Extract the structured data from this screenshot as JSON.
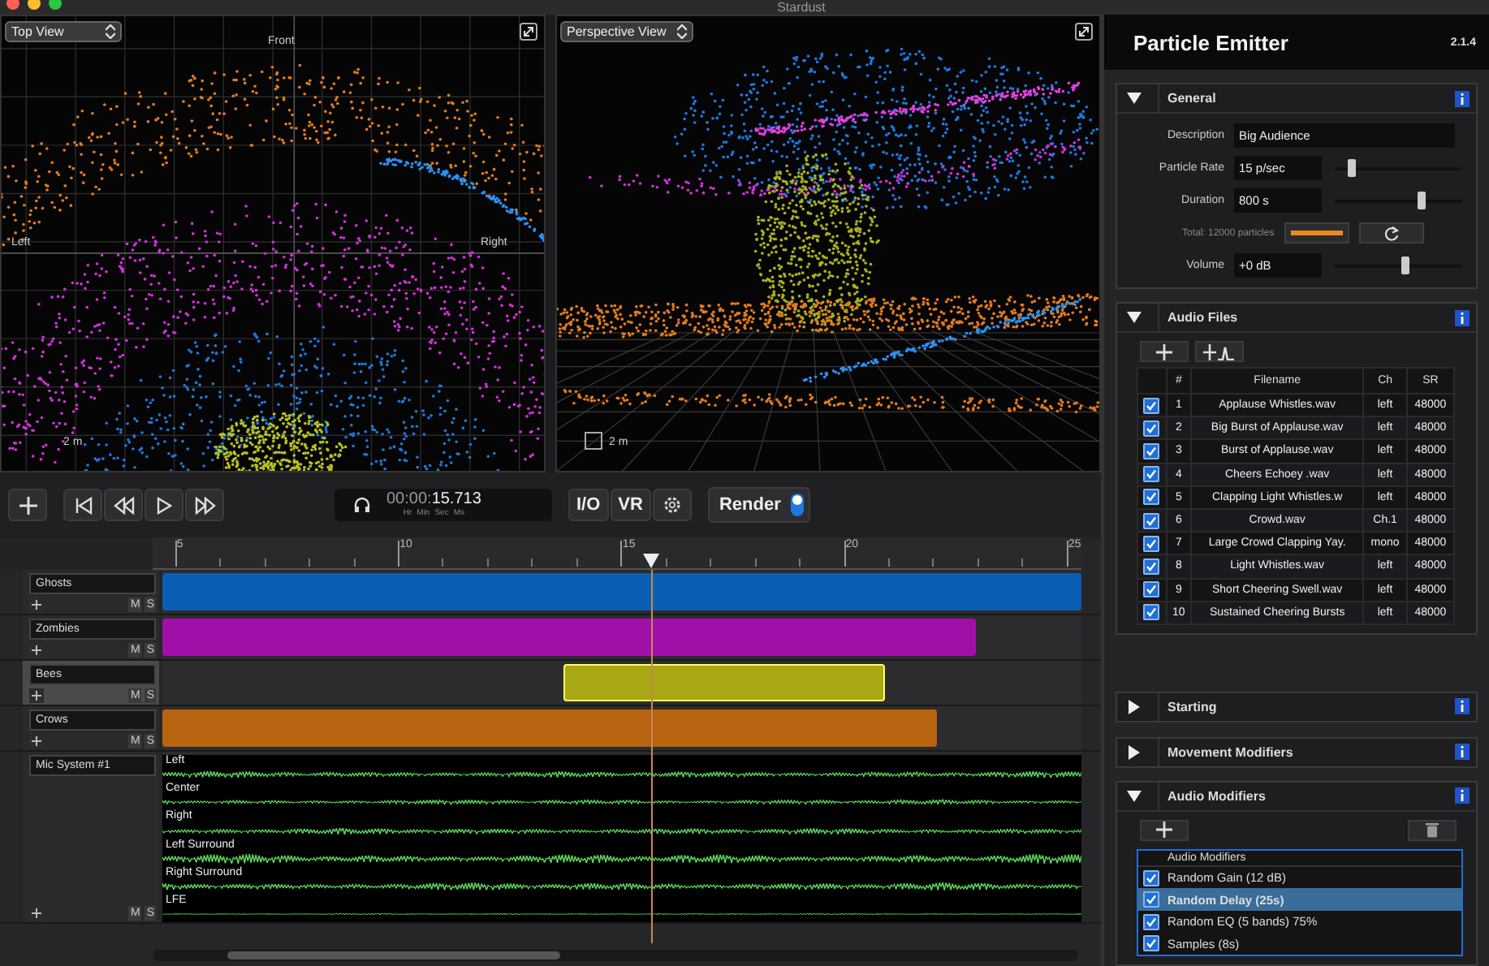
{
  "window": {
    "title": "Stardust"
  },
  "viewports": [
    {
      "kind": "top",
      "mode": "Top View",
      "front_label": "Front",
      "left_label": "Left",
      "right_label": "Right",
      "scale": "2 m"
    },
    {
      "kind": "perspective",
      "mode": "Perspective View",
      "scale": "2 m"
    }
  ],
  "transport": {
    "timecode_dim": "00:00:",
    "timecode": "15.713",
    "units": [
      "Hr",
      "Min",
      "Sec",
      "Ms"
    ],
    "buttons": [
      "I/O",
      "VR"
    ],
    "render": {
      "label": "Render",
      "on": true
    }
  },
  "ruler": [
    "5",
    "10",
    "15",
    "20",
    "25"
  ],
  "tracks": [
    {
      "kind": "clip",
      "name": "Ghosts",
      "color": "#0a5fb4",
      "selected": false,
      "mute": "M",
      "solo": "S"
    },
    {
      "kind": "clip",
      "name": "Zombies",
      "color": "#a010a8",
      "selected": false,
      "mute": "M",
      "solo": "S"
    },
    {
      "kind": "clip",
      "name": "Bees",
      "color": "#a8a814",
      "selected": true,
      "mute": "M",
      "solo": "S"
    },
    {
      "kind": "clip",
      "name": "Crows",
      "color": "#b86410",
      "selected": false,
      "mute": "M",
      "solo": "S"
    },
    {
      "kind": "mic",
      "name": "Mic System #1",
      "selected": false,
      "mute": "M",
      "solo": "S",
      "channels": [
        "Left",
        "Center",
        "Right",
        "Left Surround",
        "Right Surround",
        "LFE"
      ]
    }
  ],
  "panel": {
    "title": "Particle Emitter",
    "version": "2.1.4",
    "sections": [
      {
        "kind": "general",
        "title": "General",
        "expanded": true,
        "fields": [
          {
            "kind": "text",
            "label": "Description",
            "value": "Big Audience"
          },
          {
            "kind": "slider",
            "label": "Particle Rate",
            "value": "15 p/sec",
            "level": 0.13
          },
          {
            "kind": "slider",
            "label": "Duration",
            "value": "800 s",
            "level": 0.68
          },
          {
            "kind": "total",
            "label": "Total: 12000 particles"
          },
          {
            "kind": "slider",
            "label": "Volume",
            "value": "+0 dB",
            "level": 0.55
          }
        ]
      },
      {
        "kind": "files",
        "title": "Audio Files",
        "expanded": true,
        "columns": [
          "#",
          "Filename",
          "Ch",
          "SR"
        ],
        "rows": [
          {
            "checked": true,
            "num": "1",
            "filename": "Applause Whistles.wav",
            "ch": "left",
            "sr": "48000"
          },
          {
            "checked": true,
            "num": "2",
            "filename": "Big Burst of Applause.wav",
            "ch": "left",
            "sr": "48000"
          },
          {
            "checked": true,
            "num": "3",
            "filename": "Burst of Applause.wav",
            "ch": "left",
            "sr": "48000"
          },
          {
            "checked": true,
            "num": "4",
            "filename": "Cheers Echoey .wav",
            "ch": "left",
            "sr": "48000"
          },
          {
            "checked": true,
            "num": "5",
            "filename": "Clapping Light Whistles.w",
            "ch": "left",
            "sr": "48000"
          },
          {
            "checked": true,
            "num": "6",
            "filename": "Crowd.wav",
            "ch": "Ch.1",
            "sr": "48000"
          },
          {
            "checked": true,
            "num": "7",
            "filename": "Large Crowd Clapping Yay.",
            "ch": "mono",
            "sr": "48000"
          },
          {
            "checked": true,
            "num": "8",
            "filename": "Light Whistles.wav",
            "ch": "left",
            "sr": "48000"
          },
          {
            "checked": true,
            "num": "9",
            "filename": "Short Cheering Swell.wav",
            "ch": "left",
            "sr": "48000"
          },
          {
            "checked": true,
            "num": "10",
            "filename": "Sustained Cheering Bursts",
            "ch": "left",
            "sr": "48000"
          }
        ]
      },
      {
        "kind": "plain",
        "title": "Starting",
        "expanded": false
      },
      {
        "kind": "plain",
        "title": "Movement Modifiers",
        "expanded": false
      },
      {
        "kind": "modifiers",
        "title": "Audio Modifiers",
        "expanded": true,
        "list_title": "Audio Modifiers",
        "items": [
          {
            "label": "Random Gain (12 dB)",
            "checked": true,
            "selected": false
          },
          {
            "label": "Random Delay (25s)",
            "checked": true,
            "selected": true
          },
          {
            "label": "Random EQ (5 bands) 75%",
            "checked": true,
            "selected": false
          },
          {
            "label": "Samples (8s)",
            "checked": true,
            "selected": false
          }
        ]
      }
    ]
  }
}
